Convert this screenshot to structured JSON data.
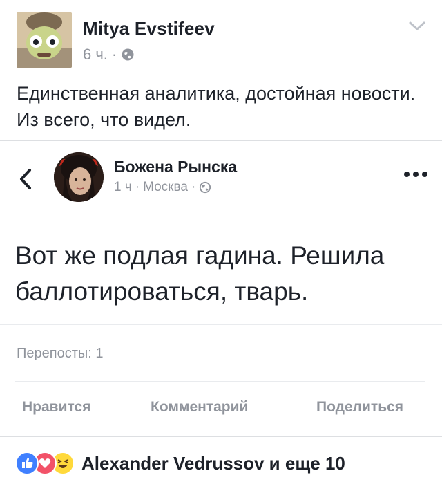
{
  "post": {
    "author": "Mitya Evstifeev",
    "time": "6 ч.",
    "separator": "·",
    "text": "Единственная аналитика, достойная новости. Из всего, что видел."
  },
  "shared": {
    "author": "Божена Рынска",
    "time": "1 ч",
    "location": "Москва",
    "separator": "·",
    "text": "Вот же подлая гадина. Решила баллотироваться, тварь.",
    "reposts": "Перепосты: 1",
    "actions": {
      "like": "Нравится",
      "comment": "Комментарий",
      "share": "Поделиться"
    }
  },
  "reactions": {
    "names": "Alexander Vedrussov и еще 10",
    "icons": [
      "like-icon",
      "love-icon",
      "haha-icon"
    ],
    "colors": {
      "like": "#4080ff",
      "love": "#f25268",
      "haha": "#ffd93b"
    }
  }
}
